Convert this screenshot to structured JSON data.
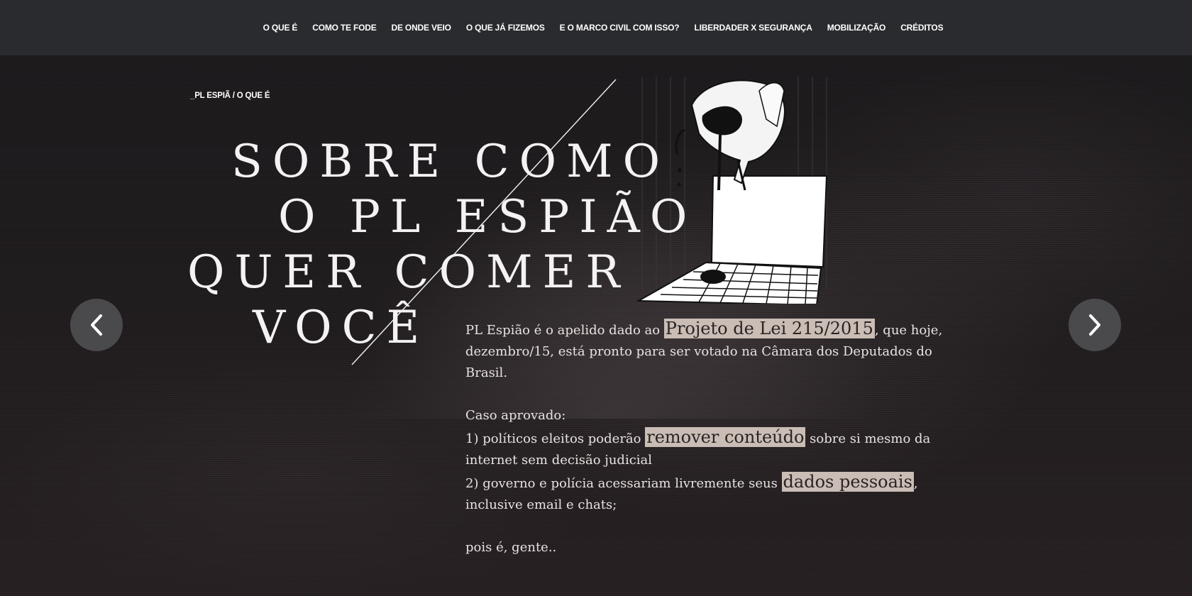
{
  "nav": {
    "items": [
      {
        "label": "O QUE É"
      },
      {
        "label": "COMO TE FODE"
      },
      {
        "label": "DE ONDE VEIO"
      },
      {
        "label": "O QUE JÁ FIZEMOS"
      },
      {
        "label": "E O MARCO CIVIL COM ISSO?"
      },
      {
        "label": "LIBERDADER X SEGURANÇA"
      },
      {
        "label": "MOBILIZAÇÃO"
      },
      {
        "label": "CRÉDITOS"
      }
    ]
  },
  "breadcrumb": "_PL ESPIÃ / O QUE É",
  "headline": {
    "line1": "SOBRE COMO",
    "line2": "O PL ESPIÃO",
    "line3": "QUER COMER",
    "line4": "VOCÊ"
  },
  "content": {
    "p1_a": "PL Espião é o apelido dado ao ",
    "p1_hl": "Projeto de Lei 215/2015",
    "p1_b": ", que hoje, dezembro/15, está pronto para ser votado na Câmara dos Deputados do  Brasil.",
    "p2_title": "Caso aprovado:",
    "p2_item1_a": "1) políticos eleitos poderão ",
    "p2_item1_hl": "remover conteúdo",
    "p2_item1_b": " sobre si mesmo da internet sem decisão judicial",
    "p2_item2_a": "2) governo e polícia acessariam livremente seus ",
    "p2_item2_hl": "dados pessoais",
    "p2_item2_b": ", inclusive email e chats;",
    "p3": "pois é, gente.."
  },
  "arrows": {
    "prev_icon": "chevron-left-icon",
    "next_icon": "chevron-right-icon"
  },
  "colors": {
    "nav_bg": "#2a2b2f",
    "highlight_bg": "#c9bdb5",
    "arrow_bg": "#4a4a4c"
  }
}
